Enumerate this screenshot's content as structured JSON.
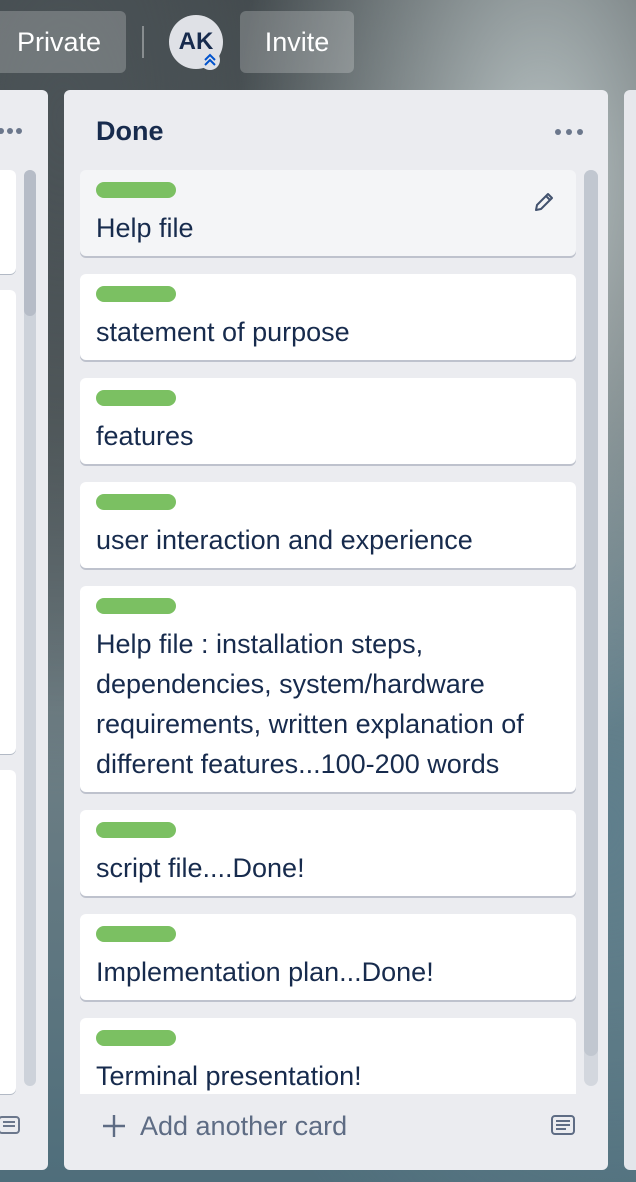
{
  "topbar": {
    "private_label": "Private",
    "avatar_initials": "AK",
    "invite_label": "Invite"
  },
  "list": {
    "title": "Done",
    "add_card_label": "Add another card",
    "label_color": "#7bc062",
    "cards": [
      {
        "text": "Help file"
      },
      {
        "text": "statement of purpose"
      },
      {
        "text": "features"
      },
      {
        "text": "user interaction and experience"
      },
      {
        "text": "Help file : installation steps, dependencies, system/hardware requirements, written explanation of different features...100-200 words"
      },
      {
        "text": "script file....Done!"
      },
      {
        "text": "Implementation plan...Done!"
      },
      {
        "text": "Terminal presentation!"
      }
    ]
  },
  "icons": {
    "menu": "ellipsis-icon",
    "edit": "pencil-icon",
    "add": "plus-icon",
    "template": "card-template-icon",
    "admin": "chevrons-up-icon"
  }
}
